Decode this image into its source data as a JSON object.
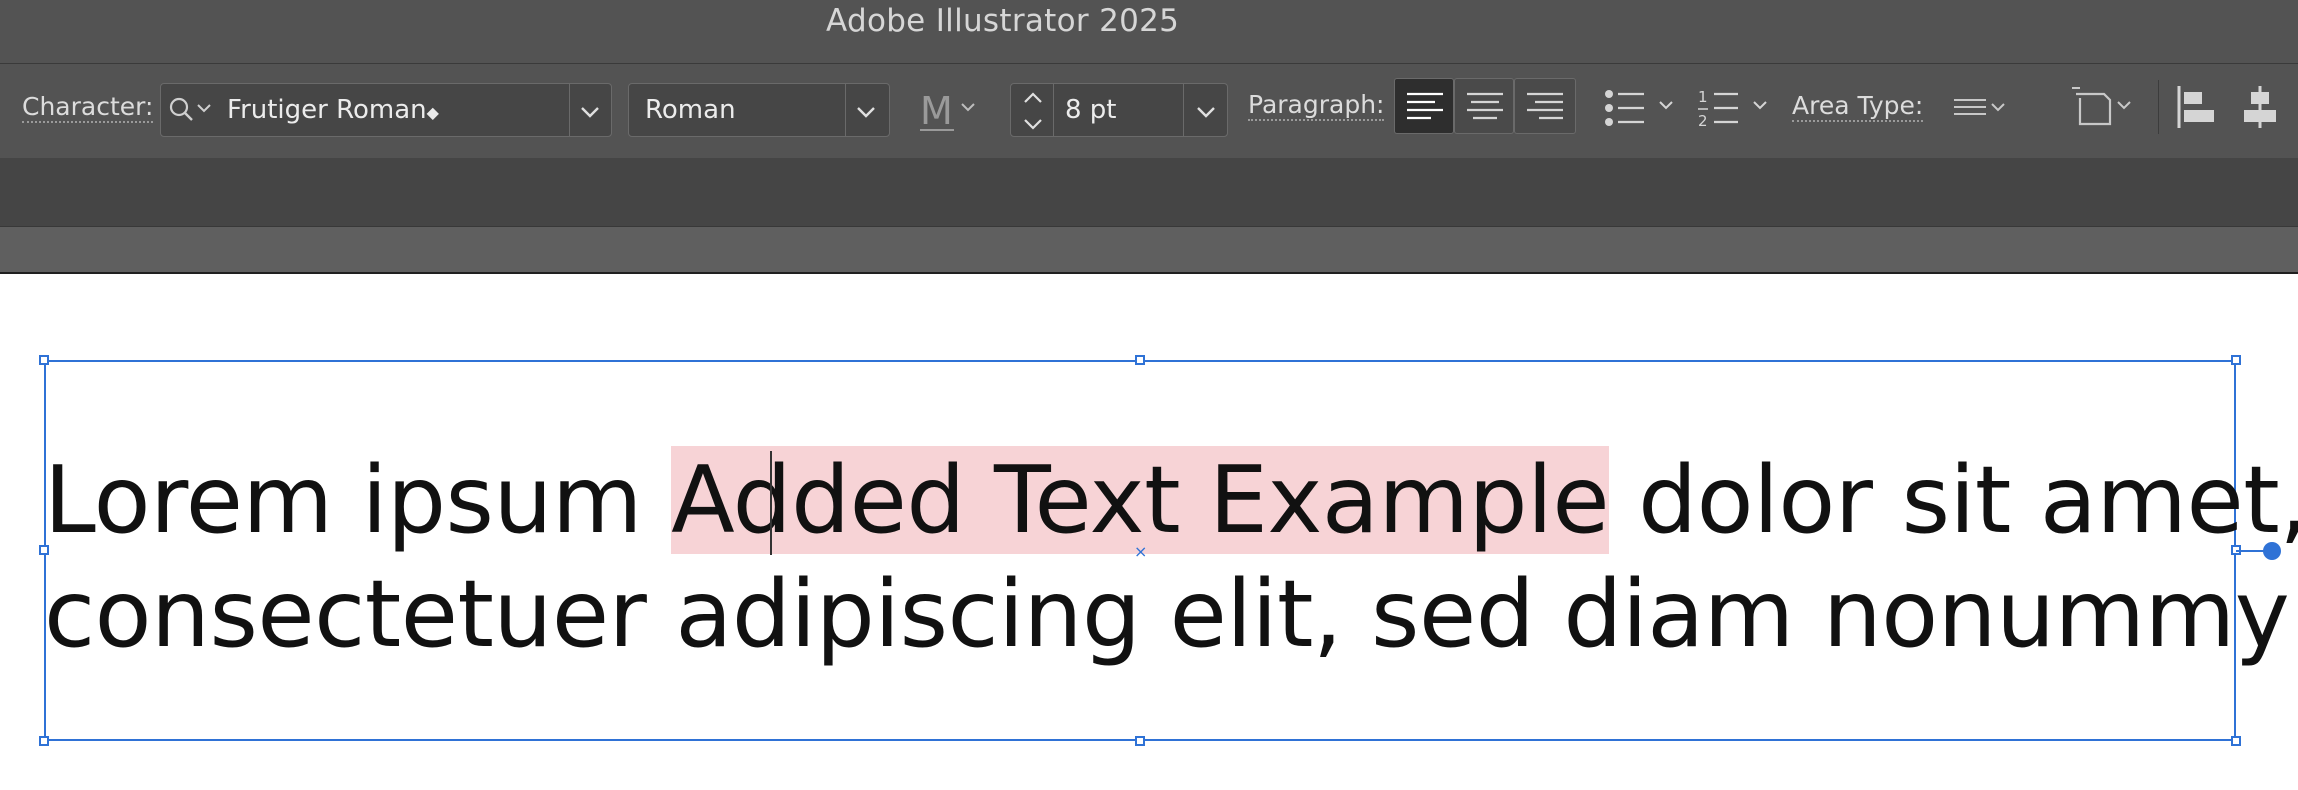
{
  "app": {
    "title": "Adobe Illustrator 2025"
  },
  "control_bar": {
    "character_label": "Character:",
    "font_family": "Frutiger Roman",
    "font_style": "Roman",
    "font_size": "8 pt",
    "paragraph_label": "Paragraph:",
    "area_type_label": "Area Type:"
  },
  "icons": [
    "search-icon",
    "chevron-down-icon",
    "touch-type-icon",
    "stepper-icon",
    "align-left-icon",
    "align-center-icon",
    "align-right-icon",
    "bullets-icon",
    "numbered-list-icon",
    "area-type-options-icon",
    "transform-icon",
    "align-left-edges-icon",
    "align-horizontal-center-icon"
  ],
  "document": {
    "line1_before": "Lorem ipsum ",
    "line1_highlight_a": "Add",
    "line1_highlight_b": "ed Text Example",
    "line1_after": " dolor sit amet,",
    "line2": "consectetuer adipiscing elit, sed diam nonummy"
  },
  "colors": {
    "selection": "#2f72d6",
    "highlight": "#f7d3d6",
    "ui_bg": "#535353"
  }
}
